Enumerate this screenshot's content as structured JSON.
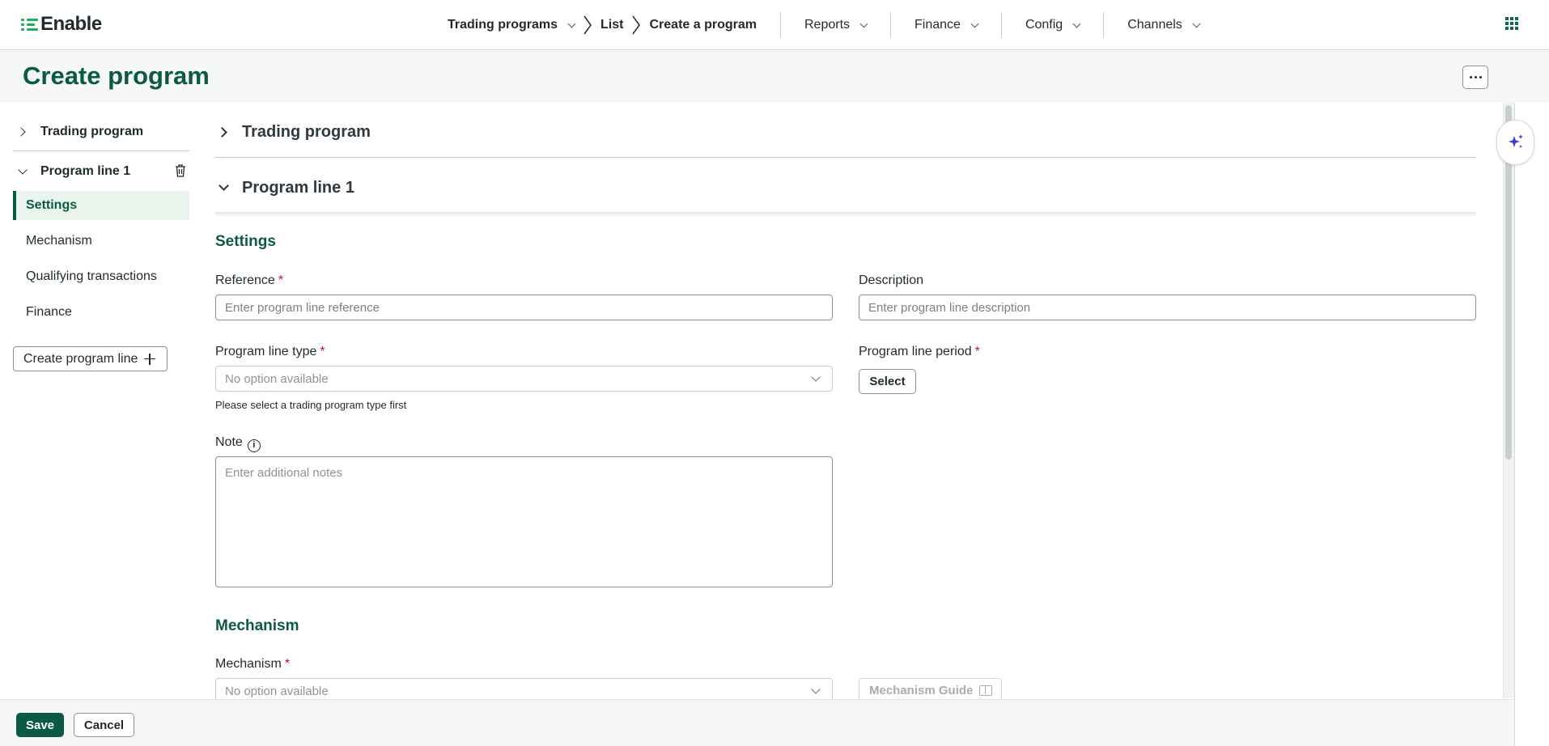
{
  "app": {
    "logo_text": "Enable",
    "brand_color": "#1fae5b",
    "accent_color": "#0c5a43"
  },
  "topnav": {
    "trading_programs": "Trading programs",
    "crumb_list": "List",
    "crumb_current": "Create a program",
    "reports": "Reports",
    "finance": "Finance",
    "config": "Config",
    "channels": "Channels"
  },
  "page": {
    "title": "Create program"
  },
  "sidebar": {
    "section_trading_program": "Trading program",
    "section_program_line": "Program line 1",
    "items": [
      "Settings",
      "Mechanism",
      "Qualifying transactions",
      "Finance"
    ],
    "active_item": "Settings",
    "create_line_label": "Create program line"
  },
  "main": {
    "acc_trading_program": "Trading program",
    "acc_program_line": "Program line 1",
    "settings": {
      "title": "Settings",
      "reference_label": "Reference",
      "reference_placeholder": "Enter program line reference",
      "description_label": "Description",
      "description_placeholder": "Enter program line description",
      "line_type_label": "Program line type",
      "line_type_value": "No option available",
      "line_type_hint": "Please select a trading program type first",
      "line_period_label": "Program line period",
      "line_period_button": "Select",
      "note_label": "Note",
      "note_placeholder": "Enter additional notes",
      "required_mark": "*"
    },
    "mechanism": {
      "title": "Mechanism",
      "mechanism_label": "Mechanism",
      "mechanism_value": "No option available",
      "guide_label": "Mechanism Guide"
    }
  },
  "footer": {
    "save_label": "Save",
    "cancel_label": "Cancel"
  }
}
